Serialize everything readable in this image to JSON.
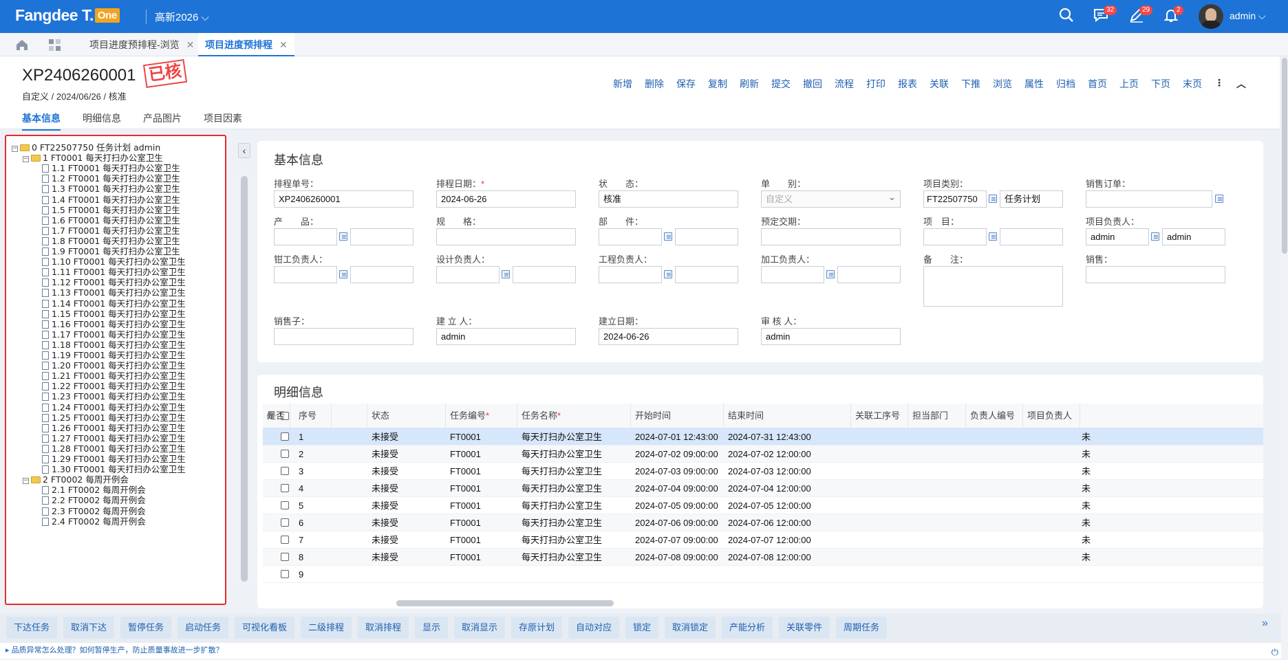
{
  "topbar": {
    "logo_main": "Fangdee T.",
    "logo_badge": "One",
    "tenant": "高新2026",
    "tenant_caret": "⌵",
    "messages_badge": "32",
    "edit_badge": "29",
    "bell_badge": "2",
    "username": "admin",
    "user_caret": "⌵"
  },
  "tabs": [
    {
      "label": "项目进度预排程-浏览",
      "close": "✕"
    },
    {
      "label": "项目进度预排程",
      "close": "✕"
    }
  ],
  "header": {
    "doc_no": "XP2406260001",
    "stamp": "已核",
    "subline": "自定义 / 2024/06/26 / 核准",
    "actions": [
      "新增",
      "删除",
      "保存",
      "复制",
      "刷新",
      "提交",
      "撤回",
      "流程",
      "打印",
      "报表",
      "关联",
      "下推",
      "浏览",
      "属性",
      "归档",
      "首页",
      "上页",
      "下页",
      "末页"
    ],
    "more": "⋮",
    "collapse": "︿",
    "subtabs": [
      "基本信息",
      "明细信息",
      "产品图片",
      "项目因素"
    ]
  },
  "tree": {
    "root": "0 FT22507750 任务计划 admin",
    "groups": [
      {
        "label": "1 FT0001 每天打扫办公室卫生",
        "children": [
          "1.1 FT0001 每天打扫办公室卫生",
          "1.2 FT0001 每天打扫办公室卫生",
          "1.3 FT0001 每天打扫办公室卫生",
          "1.4 FT0001 每天打扫办公室卫生",
          "1.5 FT0001 每天打扫办公室卫生",
          "1.6 FT0001 每天打扫办公室卫生",
          "1.7 FT0001 每天打扫办公室卫生",
          "1.8 FT0001 每天打扫办公室卫生",
          "1.9 FT0001 每天打扫办公室卫生",
          "1.10 FT0001 每天打扫办公室卫生",
          "1.11 FT0001 每天打扫办公室卫生",
          "1.12 FT0001 每天打扫办公室卫生",
          "1.13 FT0001 每天打扫办公室卫生",
          "1.14 FT0001 每天打扫办公室卫生",
          "1.15 FT0001 每天打扫办公室卫生",
          "1.16 FT0001 每天打扫办公室卫生",
          "1.17 FT0001 每天打扫办公室卫生",
          "1.18 FT0001 每天打扫办公室卫生",
          "1.19 FT0001 每天打扫办公室卫生",
          "1.20 FT0001 每天打扫办公室卫生",
          "1.21 FT0001 每天打扫办公室卫生",
          "1.22 FT0001 每天打扫办公室卫生",
          "1.23 FT0001 每天打扫办公室卫生",
          "1.24 FT0001 每天打扫办公室卫生",
          "1.25 FT0001 每天打扫办公室卫生",
          "1.26 FT0001 每天打扫办公室卫生",
          "1.27 FT0001 每天打扫办公室卫生",
          "1.28 FT0001 每天打扫办公室卫生",
          "1.29 FT0001 每天打扫办公室卫生",
          "1.30 FT0001 每天打扫办公室卫生"
        ]
      },
      {
        "label": "2 FT0002 每周开例会",
        "children": [
          "2.1 FT0002 每周开例会",
          "2.2 FT0002 每周开例会",
          "2.3 FT0002 每周开例会",
          "2.4 FT0002 每周开例会"
        ]
      }
    ],
    "collapse_btn": "‹"
  },
  "basic": {
    "title": "基本信息",
    "labels": {
      "sched_no": "排程单号：",
      "sched_date": "排程日期：",
      "status": "状　　态：",
      "doc_type": "单　　别：",
      "proj_type": "项目类别：",
      "sales_order": "销售订单：",
      "product": "产　　品：",
      "spec": "规　　格：",
      "part": "部　　件：",
      "due": "预定交期：",
      "project": "项　目：",
      "proj_owner": "项目负责人：",
      "fitter": "钳工负责人：",
      "designer": "设计负责人：",
      "engineer": "工程负责人：",
      "machinist": "加工负责人：",
      "remark": "备　　注：",
      "sales": "销售：",
      "salesman": "销售子：",
      "creator": "建 立 人：",
      "create_date": "建立日期：",
      "auditor": "审 核 人："
    },
    "values": {
      "sched_no": "XP2406260001",
      "sched_date": "2024-06-26",
      "status": "核准",
      "doc_type": "自定义",
      "proj_type_code": "FT22507750",
      "proj_type_name": "任务计划",
      "proj_owner_code": "admin",
      "proj_owner_name": "admin",
      "creator": "admin",
      "create_date": "2024-06-26",
      "auditor": "admin"
    },
    "req": "*",
    "select_caret": "⌄"
  },
  "detail": {
    "title": "明细信息",
    "attach_icon": "🖇",
    "columns": [
      "序号",
      "",
      "状态",
      "任务编号",
      "任务名称",
      "开始时间",
      "结束时间",
      "关联工序号",
      "担当部门",
      "负责人编号",
      "项目负责人",
      "是否"
    ],
    "rows": [
      {
        "no": "1",
        "status": "未接受",
        "code": "FT0001",
        "name": "每天打扫办公室卫生",
        "start": "2024-07-01 12:43:00",
        "end": "2024-07-31 12:43:00",
        "flag": "未"
      },
      {
        "no": "2",
        "status": "未接受",
        "code": "FT0001",
        "name": "每天打扫办公室卫生",
        "start": "2024-07-02 09:00:00",
        "end": "2024-07-02 12:00:00",
        "flag": "未"
      },
      {
        "no": "3",
        "status": "未接受",
        "code": "FT0001",
        "name": "每天打扫办公室卫生",
        "start": "2024-07-03 09:00:00",
        "end": "2024-07-03 12:00:00",
        "flag": "未"
      },
      {
        "no": "4",
        "status": "未接受",
        "code": "FT0001",
        "name": "每天打扫办公室卫生",
        "start": "2024-07-04 09:00:00",
        "end": "2024-07-04 12:00:00",
        "flag": "未"
      },
      {
        "no": "5",
        "status": "未接受",
        "code": "FT0001",
        "name": "每天打扫办公室卫生",
        "start": "2024-07-05 09:00:00",
        "end": "2024-07-05 12:00:00",
        "flag": "未"
      },
      {
        "no": "6",
        "status": "未接受",
        "code": "FT0001",
        "name": "每天打扫办公室卫生",
        "start": "2024-07-06 09:00:00",
        "end": "2024-07-06 12:00:00",
        "flag": "未"
      },
      {
        "no": "7",
        "status": "未接受",
        "code": "FT0001",
        "name": "每天打扫办公室卫生",
        "start": "2024-07-07 09:00:00",
        "end": "2024-07-07 12:00:00",
        "flag": "未"
      },
      {
        "no": "8",
        "status": "未接受",
        "code": "FT0001",
        "name": "每天打扫办公室卫生",
        "start": "2024-07-08 09:00:00",
        "end": "2024-07-08 12:00:00",
        "flag": "未"
      },
      {
        "no": "9",
        "status": "",
        "code": "",
        "name": "",
        "start": "",
        "end": "",
        "flag": ""
      }
    ]
  },
  "bottom_buttons": [
    "下达任务",
    "取消下达",
    "暂停任务",
    "启动任务",
    "可视化看板",
    "二级排程",
    "取消排程",
    "显示",
    "取消显示",
    "存原计划",
    "自动对应",
    "锁定",
    "取消锁定",
    "产能分析",
    "关联零件",
    "周期任务"
  ],
  "bottom_expand": "»",
  "status_bar": {
    "text": "品质异常怎么处理？如何暂停生产，防止质量事故进一步扩散？",
    "power": "⏻"
  },
  "colors": {
    "primary": "#1e73d6",
    "stamp": "#e44",
    "highlight": "#e32b2b"
  }
}
